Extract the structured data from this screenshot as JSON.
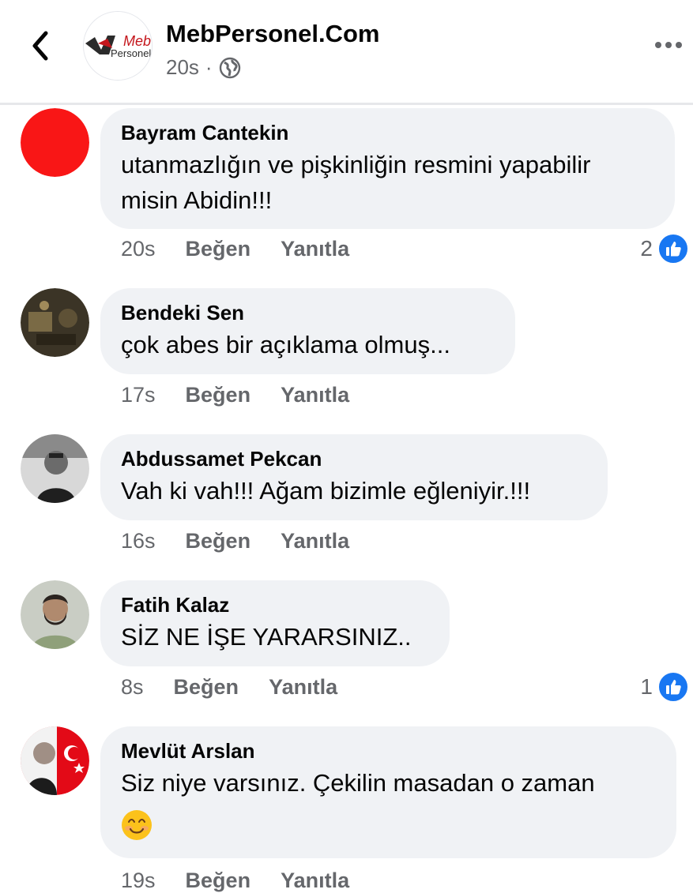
{
  "header": {
    "page_name": "MebPersonel.Com",
    "time": "20s",
    "separator": "·",
    "logo_text_top": "Meb",
    "logo_text_bottom": "Personel"
  },
  "comments": [
    {
      "author": "Bayram Cantekin",
      "lines": [
        "utanmazlığın ve pişkinliğin resmini yapabilir",
        "misin Abidin!!!"
      ],
      "time": "20s",
      "like_label": "Beğen",
      "reply_label": "Yanıtla",
      "reaction_count": "2",
      "avatar": "red-circle"
    },
    {
      "author": "Bendeki Sen",
      "lines": [
        "çok abes bir açıklama olmuş..."
      ],
      "time": "17s",
      "like_label": "Beğen",
      "reply_label": "Yanıtla",
      "avatar": "photo-dark"
    },
    {
      "author": "Abdussamet Pekcan",
      "lines": [
        "Vah ki vah!!! Ağam bizimle eğleniyir.!!!"
      ],
      "time": "16s",
      "like_label": "Beğen",
      "reply_label": "Yanıtla",
      "avatar": "photo-bw"
    },
    {
      "author": "Fatih Kalaz",
      "lines": [
        "SİZ NE İŞE YARARSINIZ.."
      ],
      "time": "8s",
      "like_label": "Beğen",
      "reply_label": "Yanıtla",
      "reaction_count": "1",
      "avatar": "photo-beard"
    },
    {
      "author": "Mevlüt Arslan",
      "lines": [
        "Siz niye varsınız. Çekilin masadan  o zaman"
      ],
      "time": "19s",
      "like_label": "Beğen",
      "reply_label": "Yanıtla",
      "emoji": "smiling-face",
      "avatar": "flag-portrait"
    }
  ],
  "colors": {
    "like_blue": "#1877f2",
    "bubble": "#f0f2f5",
    "meta_gray": "#65676b",
    "brand_red": "#c4161c"
  }
}
